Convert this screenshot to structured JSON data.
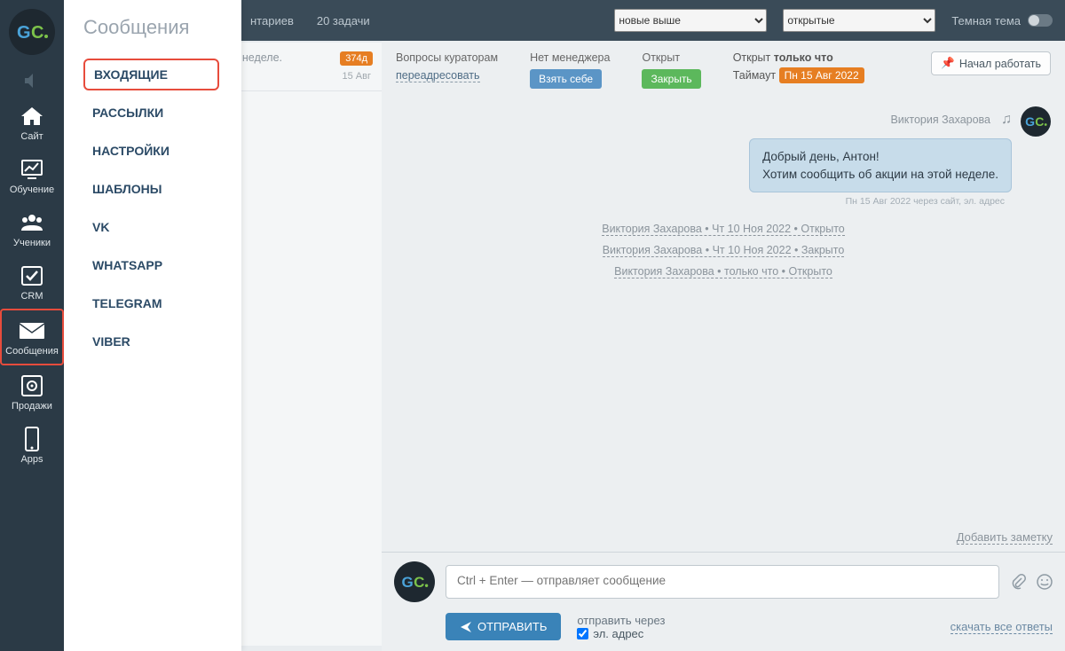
{
  "sidebar": {
    "sound_muted": true,
    "items": [
      {
        "label": "Сайт"
      },
      {
        "label": "Обучение"
      },
      {
        "label": "Ученики"
      },
      {
        "label": "CRM"
      },
      {
        "label": "Сообщения"
      },
      {
        "label": "Продажи"
      },
      {
        "label": "Apps"
      }
    ]
  },
  "submenu": {
    "title": "Сообщения",
    "items": [
      {
        "label": "ВХОДЯЩИЕ",
        "highlight": true
      },
      {
        "label": "РАССЫЛКИ"
      },
      {
        "label": "НАСТРОЙКИ"
      },
      {
        "label": "ШАБЛОНЫ"
      },
      {
        "label": "VK"
      },
      {
        "label": "WHATSAPP"
      },
      {
        "label": "TELEGRAM"
      },
      {
        "label": "VIBER"
      }
    ]
  },
  "topbar": {
    "comments_hint": "нтариев",
    "tasks": "20 задачи",
    "sort_options": [
      "новые выше"
    ],
    "filter_options": [
      "открытые"
    ],
    "theme_label": "Темная тема"
  },
  "inbox": {
    "badge": "374д",
    "preview": "и на этой неделе.",
    "date": "15 Авг"
  },
  "header": {
    "curators_title": "Вопросы кураторам",
    "forward": "переадресовать",
    "no_manager_title": "Нет менеджера",
    "take": "Взять себе",
    "open_title": "Открыт",
    "close": "Закрыть",
    "timeout_prefix": "Открыт",
    "timeout_bold": "только что",
    "timeout_label": "Таймаут",
    "timeout_tag": "Пн 15 Авг 2022",
    "pin_label": "Начал работать"
  },
  "message": {
    "sender": "Виктория Захарова",
    "line1": "Добрый день, Антон!",
    "line2": "Хотим сообщить об акции на этой неделе.",
    "meta": "Пн 15 Авг 2022 через сайт, эл. адрес"
  },
  "log": [
    "Виктория Захарова • Чт 10 Ноя 2022 • Открыто",
    "Виктория Захарова • Чт 10 Ноя 2022 • Закрыто",
    "Виктория Захарова • только что • Открыто"
  ],
  "note_link": "Добавить заметку",
  "composer": {
    "placeholder": "Ctrl + Enter — отправляет сообщение",
    "send": "ОТПРАВИТЬ",
    "send_via": "отправить через",
    "email_label": "эл. адрес",
    "download": "скачать все ответы"
  }
}
